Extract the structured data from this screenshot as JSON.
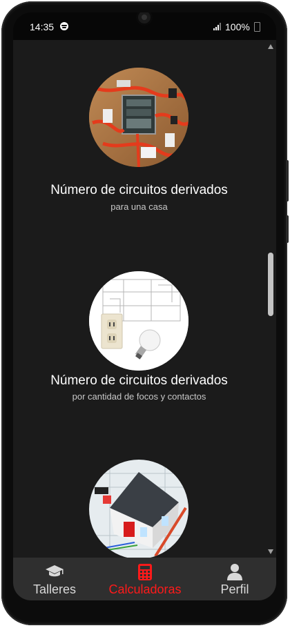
{
  "status": {
    "time": "14:35",
    "battery": "100%",
    "icons": [
      "spotify-icon",
      "signal-icon",
      "battery-icon"
    ]
  },
  "cards": [
    {
      "title": "Número de circuitos derivados",
      "subtitle": "para una casa",
      "image": "electrical-panel-photo"
    },
    {
      "title": "Número de circuitos derivados",
      "subtitle": "por cantidad de focos y contactos",
      "image": "outlet-lightbulb-blueprint-photo"
    },
    {
      "title": "",
      "subtitle": "",
      "image": "house-model-tools-photo"
    }
  ],
  "tabs": [
    {
      "label": "Talleres",
      "icon": "graduation-cap-icon",
      "active": false
    },
    {
      "label": "Calculadoras",
      "icon": "calculator-icon",
      "active": true
    },
    {
      "label": "Perfil",
      "icon": "user-icon",
      "active": false
    }
  ],
  "colors": {
    "active_tab": "#ff1a1a",
    "background": "#1b1b1b",
    "tabbar": "#2f2f2f"
  }
}
